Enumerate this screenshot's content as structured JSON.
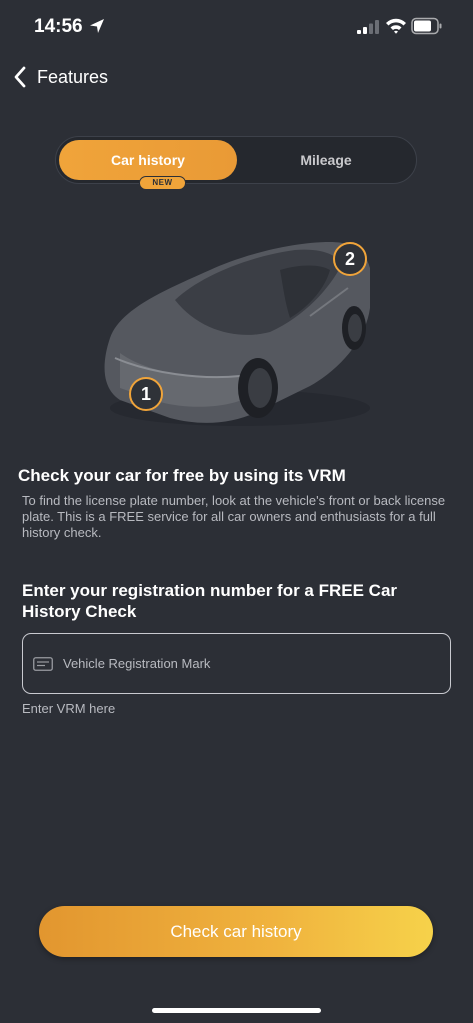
{
  "status_bar": {
    "time": "14:56",
    "icons": [
      "location-arrow-icon",
      "cellular-signal-icon",
      "wifi-icon",
      "battery-icon"
    ]
  },
  "nav": {
    "back_label": "Features"
  },
  "segments": {
    "active_label": "Car history",
    "inactive_label": "Mileage",
    "badge": "NEW"
  },
  "illustration": {
    "markers": [
      "1",
      "2"
    ]
  },
  "content": {
    "heading": "Check your car for free by using its VRM",
    "description": "To find the license plate number, look at the vehicle's front or back license plate. This is a FREE service for all car owners and enthusiasts for a full history check.",
    "registration_heading": "Enter your registration number for a FREE Car History Check"
  },
  "vrm_field": {
    "value": "",
    "placeholder": "Vehicle Registration Mark",
    "helper": "Enter VRM here"
  },
  "cta": {
    "label": "Check car history"
  },
  "colors": {
    "background": "#2c2f36",
    "accent": "#f0a43a",
    "text_secondary": "#b8bac0"
  }
}
